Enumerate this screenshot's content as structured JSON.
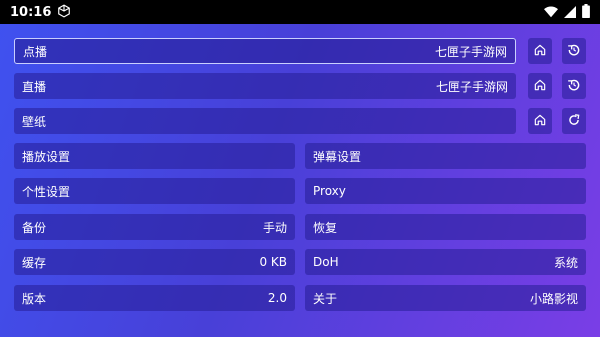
{
  "status_bar": {
    "time": "10:16"
  },
  "rows": {
    "vod": {
      "label": "点播",
      "value": "七匣子手游网"
    },
    "live": {
      "label": "直播",
      "value": "七匣子手游网"
    },
    "wallpaper": {
      "label": "壁纸"
    }
  },
  "settings": {
    "playback": {
      "label": "播放设置"
    },
    "danmaku": {
      "label": "弹幕设置"
    },
    "personalization": {
      "label": "个性设置"
    },
    "proxy": {
      "label": "Proxy"
    },
    "backup": {
      "label": "备份",
      "value": "手动"
    },
    "restore": {
      "label": "恢复"
    },
    "cache": {
      "label": "缓存",
      "value": "0 KB"
    },
    "doh": {
      "label": "DoH",
      "value": "系统"
    },
    "version": {
      "label": "版本",
      "value": "2.0"
    },
    "about": {
      "label": "关于",
      "value": "小路影视"
    }
  },
  "icons": {
    "home": "home-icon",
    "history": "history-icon",
    "refresh": "refresh-icon"
  }
}
